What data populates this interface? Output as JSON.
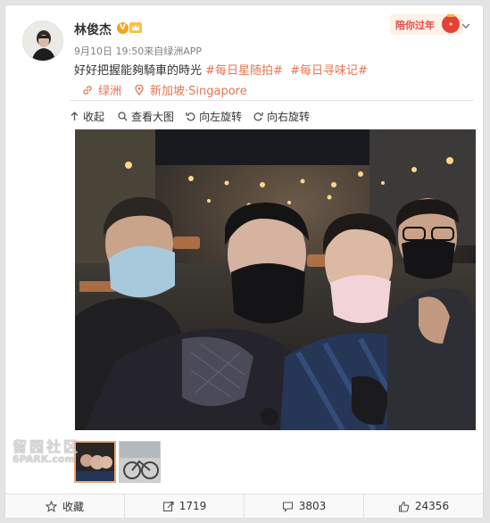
{
  "post": {
    "username": "林俊杰",
    "vip_badge": "V",
    "meta": "9月10日 19:50来自绿洲APP",
    "text_main": "好好把握能夠騎車的時光",
    "topic_1": "#每日星随拍#",
    "topic_2": "#每日寻味记#",
    "link_label": "绿洲",
    "location": "新加坡·Singapore"
  },
  "banner": {
    "label": "陪你过年"
  },
  "toolbar": {
    "collapse": "收起",
    "view_large": "查看大图",
    "rotate_left": "向左旋转",
    "rotate_right": "向右旋转"
  },
  "watermark": {
    "line1": "留园社区",
    "line2": "6PARK.com"
  },
  "footer": {
    "favorite": "收藏",
    "repost_count": "1719",
    "comment_count": "3803",
    "like_count": "24356"
  },
  "colors": {
    "accent": "#eb7350",
    "vip": "#f4a31a",
    "thumb_active_border": "#f2a36e"
  },
  "icons": [
    "crown-icon",
    "chevron-down-icon",
    "link-icon",
    "location-pin-icon",
    "collapse-icon",
    "magnify-icon",
    "rotate-left-icon",
    "rotate-right-icon",
    "star-icon",
    "repost-icon",
    "comment-icon",
    "like-icon"
  ]
}
